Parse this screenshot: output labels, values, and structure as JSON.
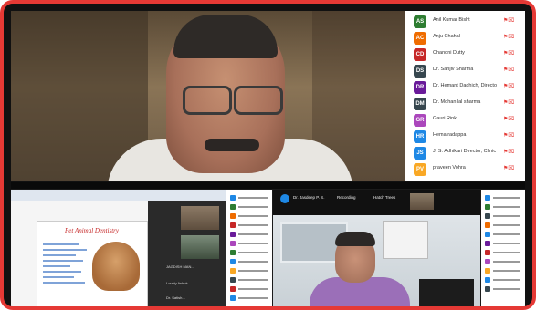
{
  "participants": [
    {
      "initials": "AS",
      "name": "Anil Kumar Bisht",
      "color": "#2e7d32"
    },
    {
      "initials": "AC",
      "name": "Anju Chahal",
      "color": "#ef6c00"
    },
    {
      "initials": "CD",
      "name": "Chandni Dutty",
      "color": "#c62828"
    },
    {
      "initials": "DS",
      "name": "Dr. Sanjiv Sharma",
      "color": "#37474f"
    },
    {
      "initials": "DR",
      "name": "Dr. Hemant Dadhich, Director ...",
      "color": "#6a1b9a"
    },
    {
      "initials": "DM",
      "name": "Dr. Mohan lal sharma",
      "color": "#37474f"
    },
    {
      "initials": "GR",
      "name": "Gauri Rink",
      "color": "#ab47bc"
    },
    {
      "initials": "HR",
      "name": "Hema radappa",
      "color": "#1e88e5"
    },
    {
      "initials": "JS",
      "name": "J. S. Adhikari Director, Clinic Res...",
      "color": "#1e88e5"
    },
    {
      "initials": "PV",
      "name": "praveen Vohra",
      "color": "#f9a825"
    }
  ],
  "share_left": {
    "slide_title": "Pet Animal Dentistry",
    "side_labels": [
      "JAGDISH MAN...",
      "Lovely Ashok",
      "Dr. Satish..."
    ]
  },
  "share_right": {
    "top_labels": [
      "Dr. Jasdeep P. S.",
      "Recording",
      "Hatch Trees"
    ]
  },
  "colors": {
    "frame_border": "#e53935",
    "icon_red": "#e53935"
  }
}
